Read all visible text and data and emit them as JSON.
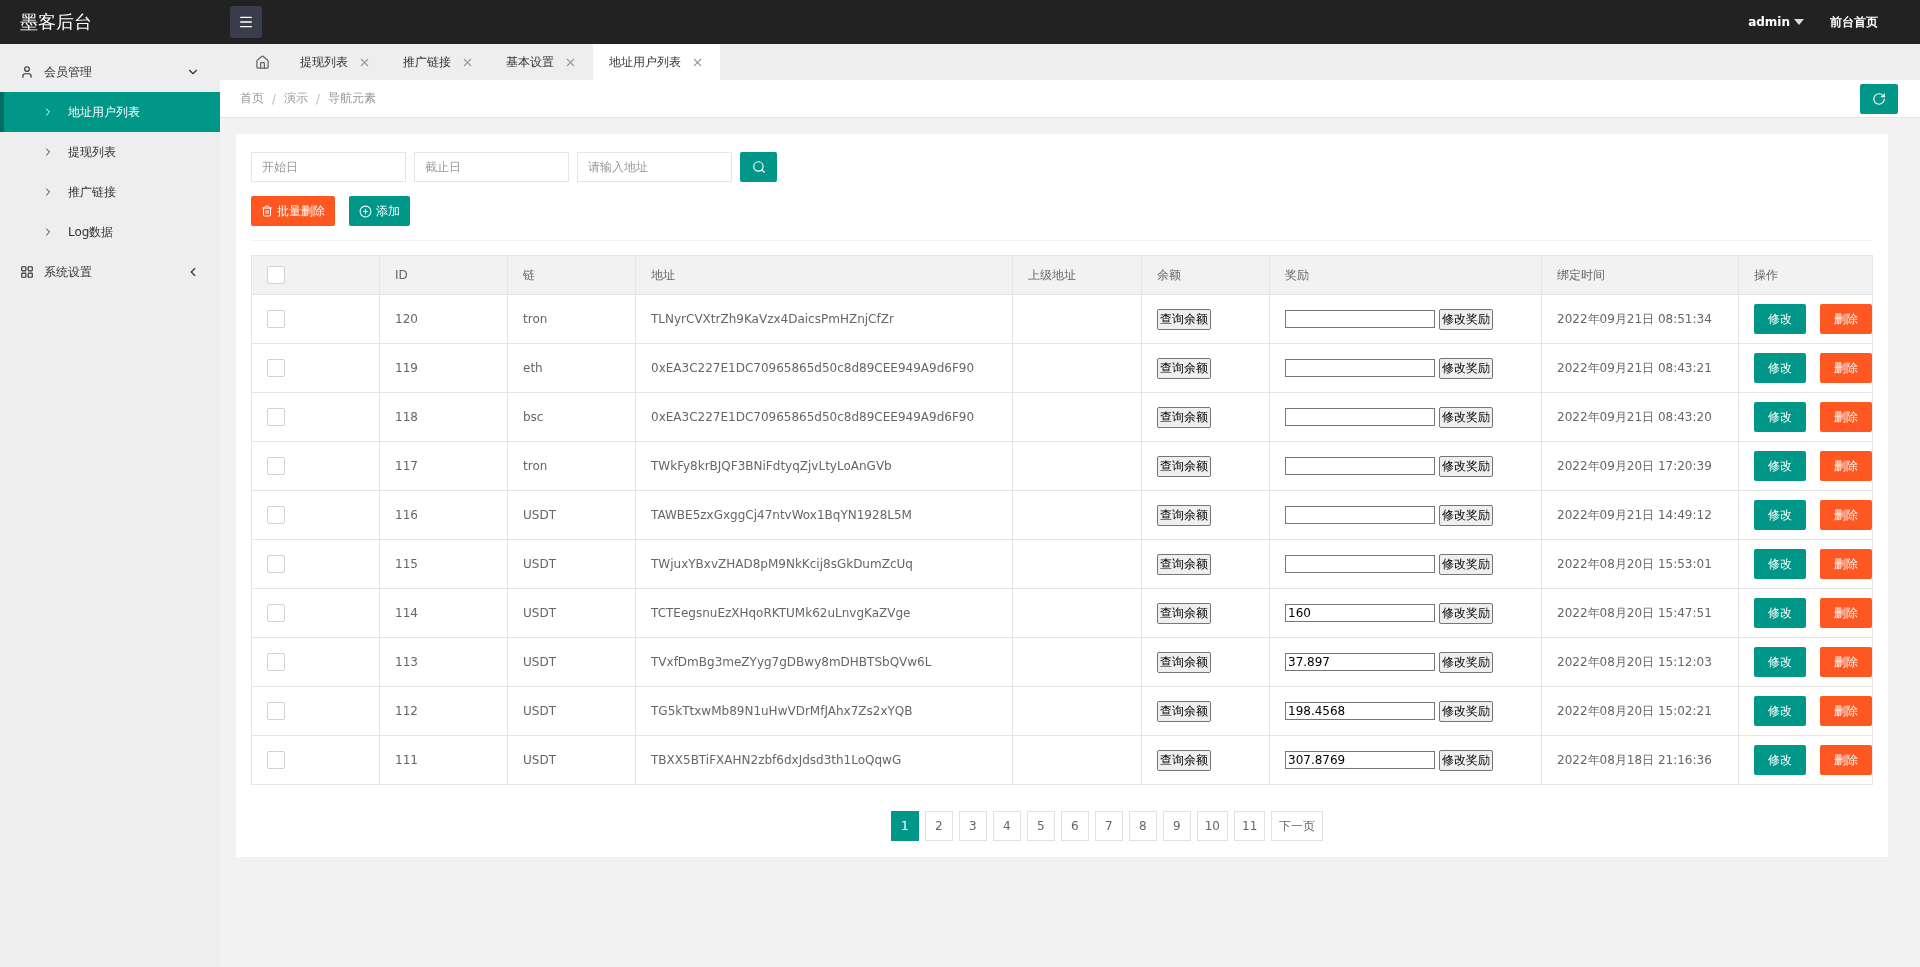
{
  "header": {
    "title": "墨客后台",
    "user": "admin",
    "frontend_link": "前台首页"
  },
  "sidebar": {
    "items": [
      {
        "label": "会员管理",
        "kind": "user",
        "expanded": true,
        "children": [
          {
            "label": "地址用户列表",
            "selected": true
          },
          {
            "label": "提现列表",
            "selected": false
          },
          {
            "label": "推广链接",
            "selected": false
          },
          {
            "label": "Log数据",
            "selected": false
          }
        ]
      },
      {
        "label": "系统设置",
        "kind": "grid",
        "expanded": false
      }
    ]
  },
  "tabs": [
    {
      "label": "提现列表",
      "selected": false
    },
    {
      "label": "推广链接",
      "selected": false
    },
    {
      "label": "基本设置",
      "selected": false
    },
    {
      "label": "地址用户列表",
      "selected": true
    }
  ],
  "breadcrumb": [
    "首页",
    "演示",
    "导航元素"
  ],
  "breadcrumb_separator": "/",
  "filters": {
    "start_placeholder": "开始日",
    "end_placeholder": "截止日",
    "address_placeholder": "请输入地址"
  },
  "actions": {
    "batch_delete": "批量删除",
    "add": "添加"
  },
  "table": {
    "all_checked": false,
    "columns": [
      "ID",
      "链",
      "地址",
      "上级地址",
      "余额",
      "奖励",
      "绑定时间",
      "操作"
    ],
    "rows": [
      {
        "checked": false,
        "id": "120",
        "chain": "tron",
        "address": "TLNyrCVXtrZh9KaVzx4DaicsPmHZnjCfZr",
        "balance_button": "查询余额",
        "reward_button": "修改奖励",
        "time": "2022年09月21日 08:51:34",
        "edit": "修改",
        "delete": "删除"
      },
      {
        "checked": false,
        "id": "119",
        "chain": "eth",
        "address": "0xEA3C227E1DC70965865d50c8d89CEE949A9d6F90",
        "balance_button": "查询余额",
        "reward_button": "修改奖励",
        "time": "2022年09月21日 08:43:21",
        "edit": "修改",
        "delete": "删除"
      },
      {
        "checked": false,
        "id": "118",
        "chain": "bsc",
        "address": "0xEA3C227E1DC70965865d50c8d89CEE949A9d6F90",
        "balance_button": "查询余额",
        "reward_button": "修改奖励",
        "time": "2022年09月21日 08:43:20",
        "edit": "修改",
        "delete": "删除"
      },
      {
        "checked": false,
        "id": "117",
        "chain": "tron",
        "address": "TWkFy8krBJQF3BNiFdtyqZjvLtyLoAnGVb",
        "balance_button": "查询余额",
        "reward_button": "修改奖励",
        "time": "2022年09月20日 17:20:39",
        "edit": "修改",
        "delete": "删除"
      },
      {
        "checked": false,
        "id": "116",
        "chain": "USDT",
        "address": "TAWBE5zxGxggCj47ntvWox1BqYN1928L5M",
        "balance_button": "查询余额",
        "reward_button": "修改奖励",
        "time": "2022年09月21日 14:49:12",
        "edit": "修改",
        "delete": "删除"
      },
      {
        "checked": false,
        "id": "115",
        "chain": "USDT",
        "address": "TWjuxYBxvZHAD8pM9NkKcij8sGkDumZcUq",
        "balance_button": "查询余额",
        "reward_button": "修改奖励",
        "time": "2022年08月20日 15:53:01",
        "edit": "修改",
        "delete": "删除"
      },
      {
        "checked": false,
        "id": "114",
        "chain": "USDT",
        "address": "TCTEegsnuEzXHqoRKTUMk62uLnvgKaZVge",
        "balance_button": "查询余额",
        "reward": "160",
        "reward_button": "修改奖励",
        "time": "2022年08月20日 15:47:51",
        "edit": "修改",
        "delete": "删除"
      },
      {
        "checked": false,
        "id": "113",
        "chain": "USDT",
        "address": "TVxfDmBg3meZYyg7gDBwy8mDHBTSbQVw6L",
        "balance_button": "查询余额",
        "reward": "37.897",
        "reward_button": "修改奖励",
        "time": "2022年08月20日 15:12:03",
        "edit": "修改",
        "delete": "删除"
      },
      {
        "checked": false,
        "id": "112",
        "chain": "USDT",
        "address": "TG5kTtxwMb89N1uHwVDrMfJAhx7Zs2xYQB",
        "balance_button": "查询余额",
        "reward": "198.4568",
        "reward_button": "修改奖励",
        "time": "2022年08月20日 15:02:21",
        "edit": "修改",
        "delete": "删除"
      },
      {
        "checked": false,
        "id": "111",
        "chain": "USDT",
        "address": "TBXX5BTiFXAHN2zbf6dxJdsd3th1LoQqwG",
        "balance_button": "查询余额",
        "reward": "307.8769",
        "reward_button": "修改奖励",
        "time": "2022年08月18日 21:16:36",
        "edit": "修改",
        "delete": "删除"
      }
    ]
  },
  "pagination": {
    "pages": [
      {
        "label": "1",
        "selected": true
      },
      {
        "label": "2",
        "selected": false
      },
      {
        "label": "3",
        "selected": false
      },
      {
        "label": "4",
        "selected": false
      },
      {
        "label": "5",
        "selected": false
      },
      {
        "label": "6",
        "selected": false
      },
      {
        "label": "7",
        "selected": false
      },
      {
        "label": "8",
        "selected": false
      },
      {
        "label": "9",
        "selected": false
      },
      {
        "label": "10",
        "selected": false
      },
      {
        "label": "11",
        "selected": false
      }
    ],
    "next": "下一页"
  }
}
